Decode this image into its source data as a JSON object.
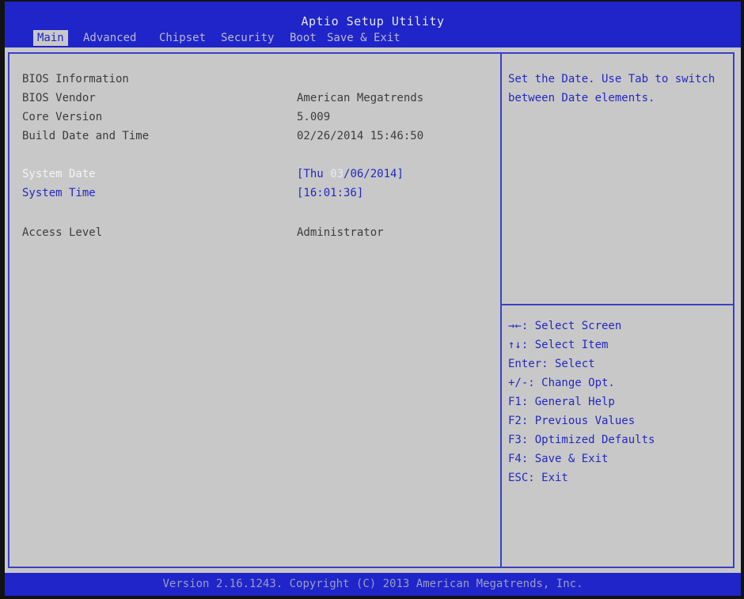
{
  "app": {
    "title": "Aptio Setup Utility"
  },
  "tabs": [
    {
      "label": "Main",
      "active": true
    },
    {
      "label": "Advanced"
    },
    {
      "label": "Chipset"
    },
    {
      "label": "Security"
    },
    {
      "label": "Boot"
    },
    {
      "label": "Save & Exit"
    }
  ],
  "info": {
    "section_title": "BIOS Information",
    "vendor_label": "BIOS Vendor",
    "vendor_value": "American Megatrends",
    "core_label": "Core Version",
    "core_value": "5.009",
    "build_label": "Build Date and Time",
    "build_value": "02/26/2014 15:46:50"
  },
  "settings": {
    "date_label": "System Date",
    "date_prefix": "[Thu ",
    "date_month": "03",
    "date_rest": "/06/2014]",
    "time_label": "System Time",
    "time_value": "[16:01:36]",
    "access_label": "Access Level",
    "access_value": "Administrator"
  },
  "help": {
    "description": "Set the Date. Use Tab to switch between Date elements.",
    "keys": [
      "→←: Select Screen",
      "↑↓: Select Item",
      "Enter: Select",
      "+/-: Change Opt.",
      "F1: General Help",
      "F2: Previous Values",
      "F3: Optimized Defaults",
      "F4: Save & Exit",
      "ESC: Exit"
    ]
  },
  "footer": {
    "text": "Version 2.16.1243. Copyright (C) 2013 American Megatrends, Inc."
  },
  "colors": {
    "header_blue": "#1f25c8",
    "panel_gray": "#c8c8c8",
    "link_blue": "#2428c0"
  }
}
